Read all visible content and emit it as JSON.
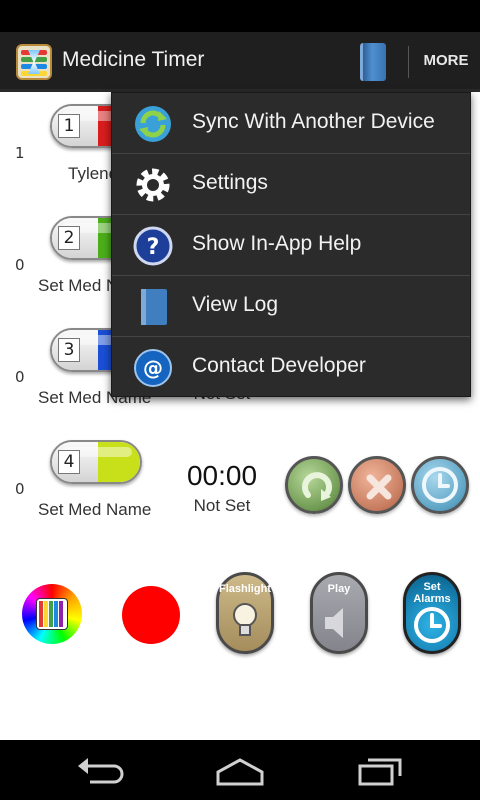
{
  "app": {
    "title": "Medicine Timer",
    "more_label": "MORE"
  },
  "rows": [
    {
      "count": "1",
      "number": "1",
      "name": "Tylenol",
      "color": "#d81d1d",
      "timer": "",
      "status": ""
    },
    {
      "count": "0",
      "number": "2",
      "name": "Set Med Name",
      "color": "#4caf1a",
      "timer": "",
      "status": ""
    },
    {
      "count": "0",
      "number": "3",
      "name": "Set Med Name",
      "color": "#1a4fd6",
      "timer": "",
      "status": "Not Set"
    },
    {
      "count": "0",
      "number": "4",
      "name": "Set Med Name",
      "color": "#c8e01a",
      "timer": "00:00",
      "status": "Not Set"
    }
  ],
  "tools": {
    "flashlight_label": "Flashlight",
    "play_label": "Play",
    "set_alarms_label": "Set Alarms"
  },
  "menu": {
    "items": [
      {
        "label": "Sync With Another Device",
        "icon": "sync-icon"
      },
      {
        "label": "Settings",
        "icon": "gear-icon"
      },
      {
        "label": "Show In-App Help",
        "icon": "help-icon"
      },
      {
        "label": "View Log",
        "icon": "log-book-icon"
      },
      {
        "label": "Contact Developer",
        "icon": "at-sign-icon"
      }
    ]
  }
}
